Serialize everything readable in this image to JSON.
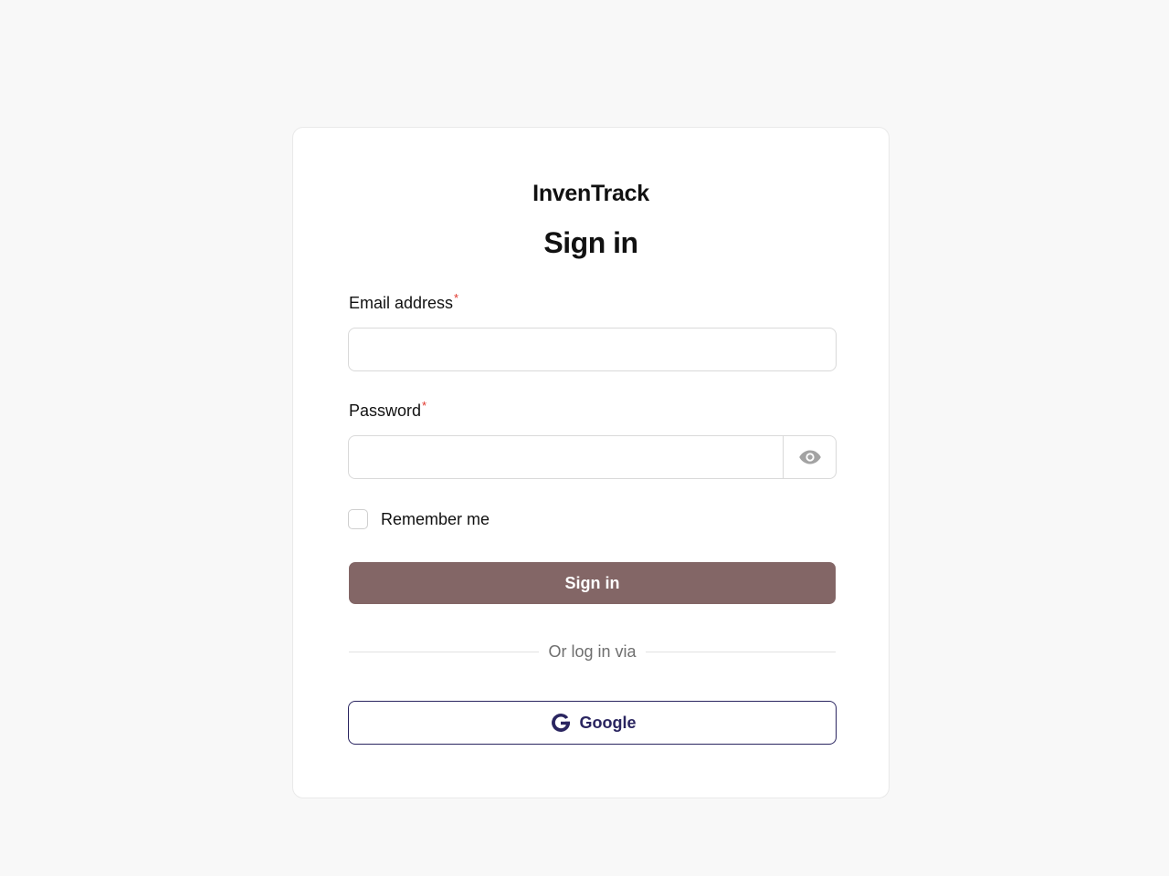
{
  "brand": "InvenTrack",
  "title": "Sign in",
  "email": {
    "label": "Email address",
    "required_marker": "*",
    "value": "",
    "placeholder": ""
  },
  "password": {
    "label": "Password",
    "required_marker": "*",
    "value": "",
    "placeholder": "",
    "toggle_icon": "eye-icon"
  },
  "remember": {
    "label": "Remember me",
    "checked": false
  },
  "submit_label": "Sign in",
  "divider_text": "Or log in via",
  "google": {
    "label": "Google",
    "icon": "google-icon"
  },
  "colors": {
    "primary_button": "#836666",
    "google_accent": "#2a2560",
    "required": "#e0352b",
    "background": "#f8f8f8"
  }
}
